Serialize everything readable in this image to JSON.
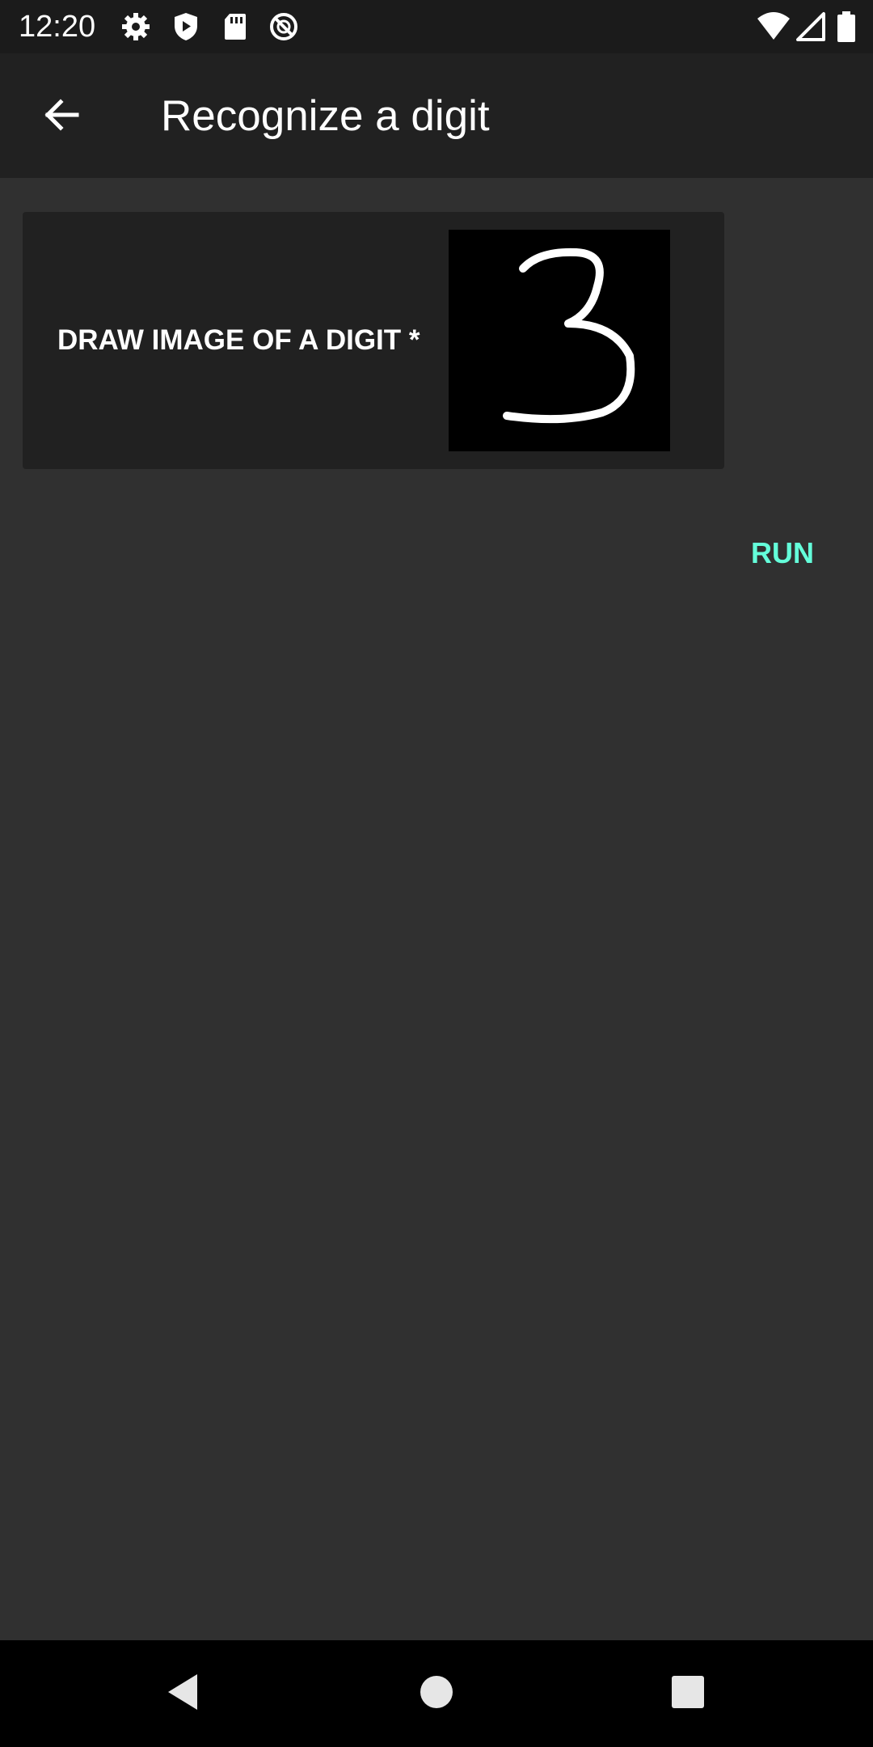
{
  "status_bar": {
    "time": "12:20",
    "left_icons": [
      "gear-icon",
      "shield-play-icon",
      "sd-card-icon",
      "do-not-disturb-icon"
    ],
    "right_icons": [
      "wifi-icon",
      "cell-signal-icon",
      "battery-icon"
    ]
  },
  "app_bar": {
    "back_icon": "arrow-back-icon",
    "title": "Recognize a digit"
  },
  "form": {
    "field_label": "DRAW IMAGE OF A DIGIT *",
    "drawn_digit": "3",
    "run_label": "RUN"
  },
  "colors": {
    "background": "#303030",
    "app_bar": "#212121",
    "card": "#212121",
    "accent": "#64ffda"
  },
  "nav_bar": {
    "buttons": [
      "back-triangle-icon",
      "home-circle-icon",
      "recents-square-icon"
    ]
  }
}
